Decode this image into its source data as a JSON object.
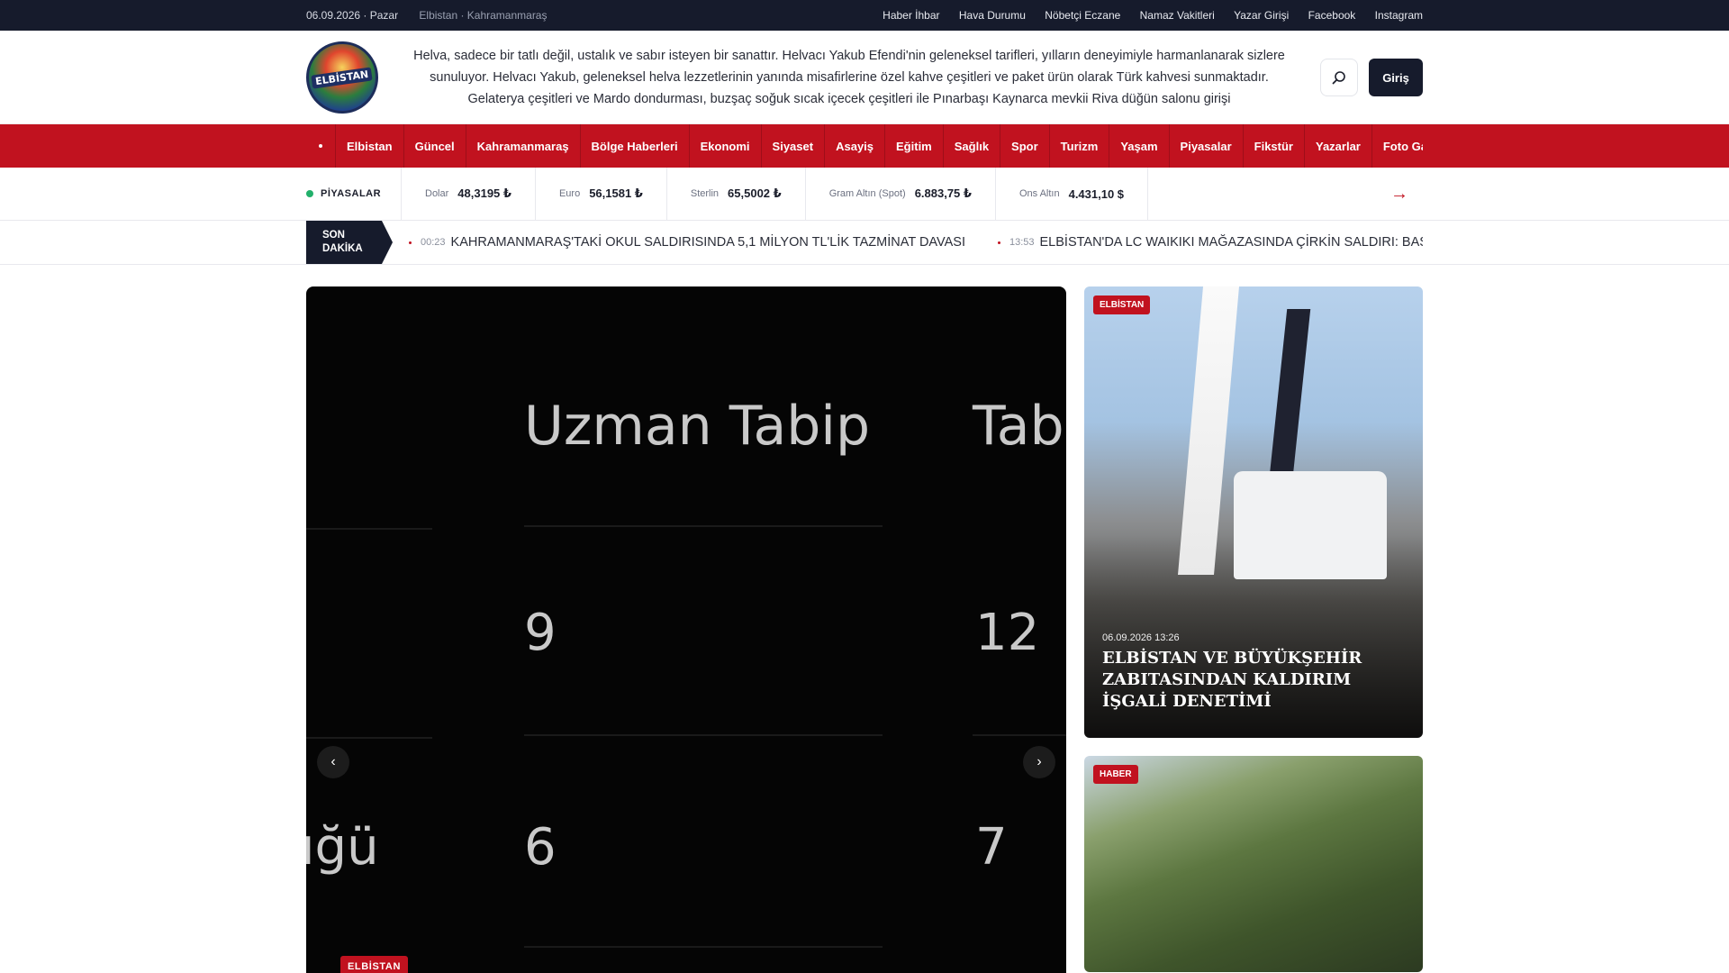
{
  "topbar": {
    "date": "06.09.2026 · Pazar",
    "location": "Elbistan · Kahramanmaraş",
    "links": [
      "Haber İhbar",
      "Hava Durumu",
      "Nöbetçi Eczane",
      "Namaz Vakitleri",
      "Yazar Girişi",
      "Facebook",
      "Instagram"
    ]
  },
  "header": {
    "logo_text": "ELBİSTAN",
    "intro": "Helva, sadece bir tatlı değil, ustalık ve sabır isteyen bir sanattır. Helvacı Yakub Efendi'nin geleneksel tarifleri, yılların deneyimiyle harmanlanarak sizlere sunuluyor. Helvacı Yakub, geleneksel helva lezzetlerinin yanında misafirlerine özel kahve çeşitleri ve paket ürün olarak Türk kahvesi sunmaktadır. Gelaterya çeşitleri ve Mardo dondurması, buzşaç soğuk sıcak içecek çeşitleri ile Pınarbaşı Kaynarca mevkii Riva düğün salonu girişi",
    "search_icon": "search-icon",
    "login_label": "Giriş"
  },
  "nav": {
    "items": [
      "Elbistan",
      "Güncel",
      "Kahramanmaraş",
      "Bölge Haberleri",
      "Ekonomi",
      "Siyaset",
      "Asayiş",
      "Eğitim",
      "Sağlık",
      "Spor",
      "Turizm",
      "Yaşam",
      "Piyasalar",
      "Fikstür",
      "Yazarlar",
      "Foto Ga"
    ]
  },
  "markets": {
    "label": "PİYASALAR",
    "items": [
      {
        "name": "Dolar",
        "value": "48,3195 ₺"
      },
      {
        "name": "Euro",
        "value": "56,1581 ₺"
      },
      {
        "name": "Sterlin",
        "value": "65,5002 ₺"
      },
      {
        "name": "Gram Altın (Spot)",
        "value": "6.883,75 ₺"
      },
      {
        "name": "Ons Altın",
        "value": "4.431,10 $"
      }
    ],
    "arrow": "→"
  },
  "breaking": {
    "label_line1": "SON",
    "label_line2": "DAKİKA",
    "items": [
      {
        "time": "00:23",
        "text": "KAHRAMANMARAŞ'TAKİ OKUL SALDIRISINDA 5,1 MİLYON TL'LİK TAZMİNAT DAVASI"
      },
      {
        "time": "13:53",
        "text": "ELBİSTAN'DA LC WAIKIKI MAĞAZASINDA ÇİRKİN SALDIRI: BAŞÖRTÜS"
      }
    ]
  },
  "slider": {
    "words": [
      "Uzman Tabip",
      "Tab",
      "9",
      "12",
      "6",
      "7",
      "ığü"
    ],
    "prev": "‹",
    "next": "›",
    "tag": "ELBİSTAN"
  },
  "side": {
    "cards": [
      {
        "tag": "ELBİSTAN",
        "date": "06.09.2026 13:26",
        "title": "ELBİSTAN VE BÜYÜKŞEHİR ZABITASINDAN KALDIRIM İŞGALİ DENETİMİ"
      },
      {
        "tag": "HABER"
      }
    ]
  }
}
